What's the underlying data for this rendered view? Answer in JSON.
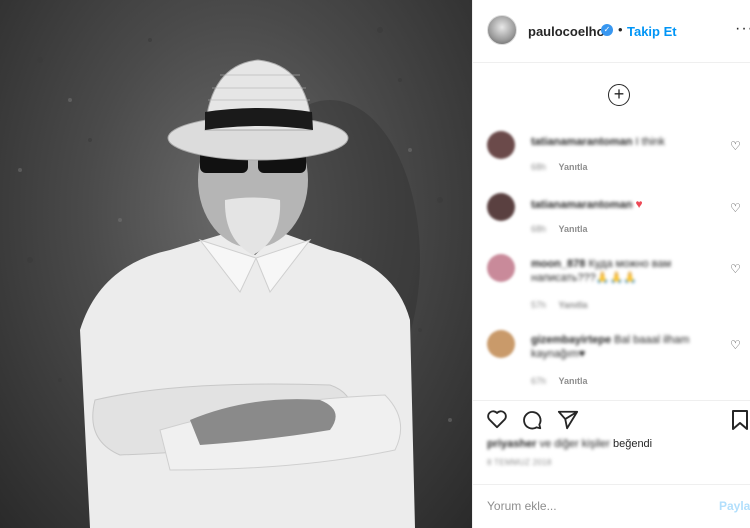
{
  "post": {
    "username": "paulocoelho",
    "separator": "•",
    "follow_label": "Takip Et",
    "more_label": "···",
    "load_more_label": "+"
  },
  "comments": [
    {
      "user": "tatianamarantoman",
      "text": "I think",
      "time": "68h",
      "reply": "Yanıtla",
      "avatar_color": "#6b4a4a"
    },
    {
      "user": "tatianamarantoman",
      "text": "♥",
      "time": "68h",
      "reply": "Yanıtla",
      "avatar_color": "#5a4040"
    },
    {
      "user": "moon_878",
      "text": "Куда можно вам написать???🙏🙏🙏",
      "time": "57h",
      "reply": "Yanıtla",
      "avatar_color": "#c98a9a"
    },
    {
      "user": "gizembayirtepe",
      "text": "Bal baaal ilham kaynağım♥",
      "time": "67h",
      "reply": "Yanıtla",
      "avatar_color": "#c99a6a"
    }
  ],
  "likes": {
    "liker": "priyasher",
    "others_label": "ve diğer kişiler",
    "liked_label": "beğendi"
  },
  "date_label": "8 TEMMUZ 2018",
  "add_comment": {
    "placeholder": "Yorum ekle...",
    "post_label": "Paylaş"
  }
}
